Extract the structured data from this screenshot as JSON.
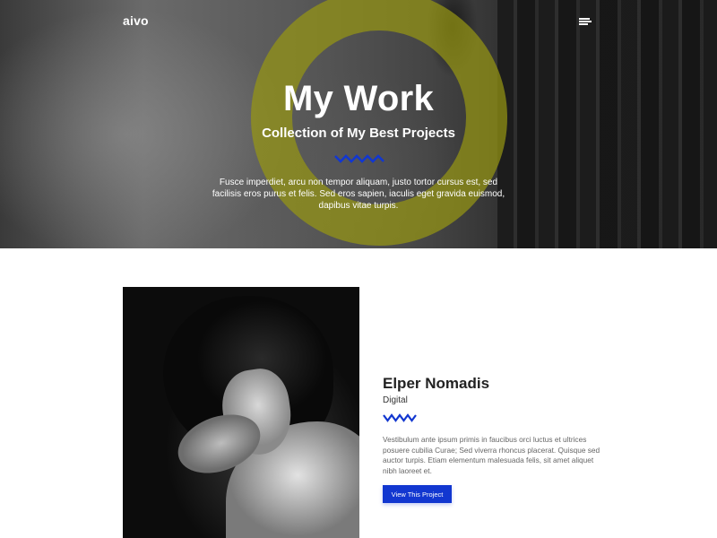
{
  "header": {
    "brand": "aivo",
    "menu_icon": "hamburger-menu-icon"
  },
  "hero": {
    "title": "My Work",
    "subtitle": "Collection of My Best Projects",
    "description": "Fusce imperdiet, arcu non tempor aliquam, justo tortor cursus est, sed facilisis eros purus et felis. Sed eros sapien, iaculis eget gravida euismod, dapibus vitae turpis.",
    "divider_icon": "zigzag-divider-icon",
    "accent_color": "#1237d0",
    "ring_color": "#9a9a15"
  },
  "project": {
    "title": "Elper Nomadis",
    "category": "Digital",
    "description": "Vestibulum ante ipsum primis in faucibus orci luctus et ultrices posuere cubilia Curae; Sed viverra rhoncus placerat. Quisque sed auctor turpis. Etiam elementum malesuada felis, sit amet aliquet nibh laoreet et.",
    "button_label": "View This Project",
    "divider_icon": "zigzag-divider-icon",
    "button_color": "#1237d0"
  }
}
